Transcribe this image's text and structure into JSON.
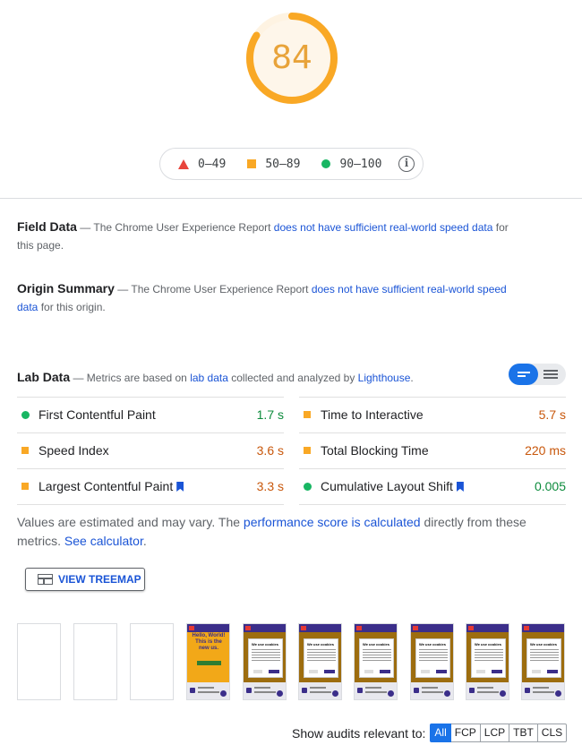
{
  "score": {
    "value": "84",
    "fraction": 0.84,
    "color": "#e8a33a",
    "track_color": "#fef3e2"
  },
  "legend": {
    "fail": "0–49",
    "average": "50–89",
    "pass": "90–100",
    "info_icon": "info-icon"
  },
  "field_data": {
    "heading": "Field Data",
    "text_before": "— The Chrome User Experience Report ",
    "link": "does not have sufficient real-world speed data",
    "text_after": " for this page."
  },
  "origin_summary": {
    "heading": "Origin Summary",
    "text_before": "— The Chrome User Experience Report ",
    "link": "does not have sufficient real-world speed data",
    "text_after": " for this origin."
  },
  "lab_data": {
    "heading": "Lab Data",
    "text_before": "— Metrics are based on ",
    "link1": "lab data",
    "text_mid": " collected and analyzed by ",
    "link2": "Lighthouse",
    "text_after": "."
  },
  "metrics": [
    {
      "name": "First Contentful Paint",
      "value": "1.7 s",
      "status": "pass"
    },
    {
      "name": "Time to Interactive",
      "value": "5.7 s",
      "status": "average"
    },
    {
      "name": "Speed Index",
      "value": "3.6 s",
      "status": "average"
    },
    {
      "name": "Total Blocking Time",
      "value": "220 ms",
      "status": "average"
    },
    {
      "name": "Largest Contentful Paint",
      "value": "3.3 s",
      "status": "average",
      "core_web_vital": true
    },
    {
      "name": "Cumulative Layout Shift",
      "value": "0.005",
      "status": "pass",
      "core_web_vital": true
    }
  ],
  "note": {
    "text1": "Values are estimated and may vary. The ",
    "link1": "performance score is calculated",
    "text2": " directly from these metrics. ",
    "link2": "See calculator",
    "text3": "."
  },
  "treemap_button": "VIEW TREEMAP",
  "filmstrip": {
    "hero_text": "Hello, World! This is the new us.",
    "dialog_title": "We use cookies"
  },
  "audits": {
    "label": "Show audits relevant to:",
    "filters": [
      "All",
      "FCP",
      "LCP",
      "TBT",
      "CLS"
    ],
    "active": "All"
  }
}
